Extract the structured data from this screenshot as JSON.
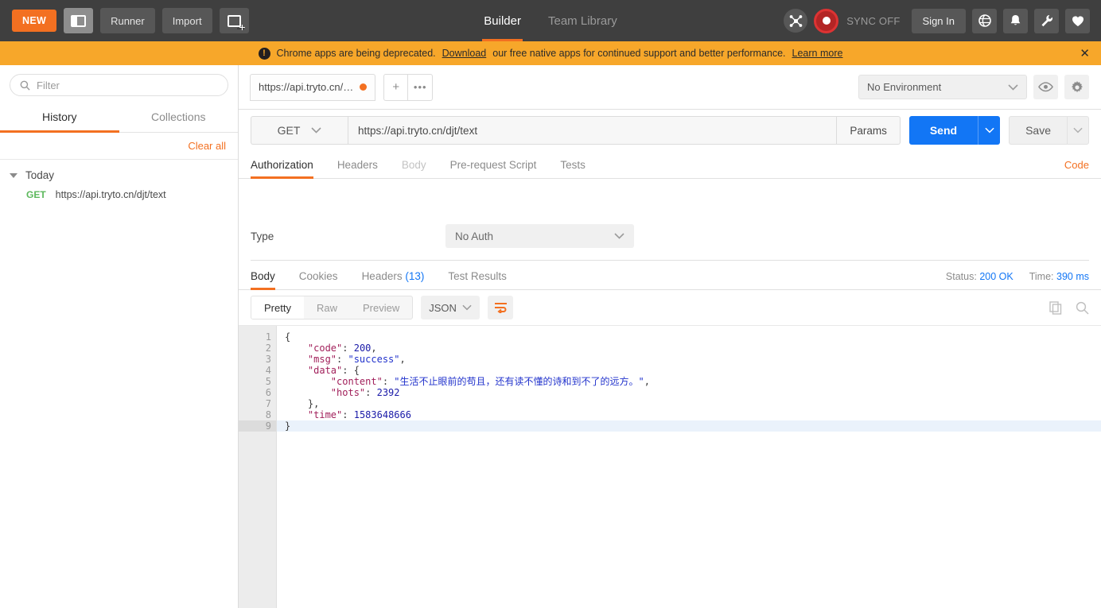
{
  "header": {
    "new_label": "NEW",
    "sidebar_toggle_name": "sidebar-layout-toggle",
    "runner_label": "Runner",
    "import_label": "Import",
    "new_tab_name": "new-window",
    "tabs": [
      {
        "label": "Builder",
        "active": true
      },
      {
        "label": "Team Library",
        "active": false
      }
    ],
    "interceptor_icon": "interceptor-icon",
    "sync_status": "SYNC OFF",
    "sign_in_label": "Sign In",
    "right_icons": [
      "globe-icon",
      "bell-icon",
      "wrench-icon",
      "heart-icon"
    ],
    "accent_color": "#f37021"
  },
  "banner": {
    "icon": "exclamation-icon",
    "text_before": "Chrome apps are being deprecated. ",
    "link1": "Download",
    "text_middle": " our free native apps for continued support and better performance. ",
    "link2": "Learn more",
    "close_label": "✕",
    "background": "#f7a72a"
  },
  "sidebar": {
    "filter_placeholder": "Filter",
    "search_icon": "search-icon",
    "tabs": [
      {
        "label": "History",
        "active": true
      },
      {
        "label": "Collections",
        "active": false
      }
    ],
    "clear_all_label": "Clear all",
    "group_label": "Today",
    "history_items": [
      {
        "method": "GET",
        "url": "https://api.tryto.cn/djt/text"
      }
    ]
  },
  "tabstrip": {
    "request_tab_label": "https://api.tryto.cn/…",
    "unsaved_indicator": "unsaved-dot",
    "add_tab_label": "+",
    "more_tabs_label": "•••",
    "environment_value": "No Environment",
    "eye_icon": "eye-icon",
    "gear_icon": "gear-icon"
  },
  "request": {
    "method": "GET",
    "url": "https://api.tryto.cn/djt/text",
    "params_label": "Params",
    "send_label": "Send",
    "save_label": "Save",
    "tabs": [
      {
        "label": "Authorization",
        "active": true,
        "disabled": false
      },
      {
        "label": "Headers",
        "active": false,
        "disabled": false
      },
      {
        "label": "Body",
        "active": false,
        "disabled": true
      },
      {
        "label": "Pre-request Script",
        "active": false,
        "disabled": false
      },
      {
        "label": "Tests",
        "active": false,
        "disabled": false
      }
    ],
    "code_label": "Code",
    "auth": {
      "type_label": "Type",
      "type_value": "No Auth"
    }
  },
  "response": {
    "tabs": [
      {
        "label": "Body",
        "active": true,
        "count": ""
      },
      {
        "label": "Cookies",
        "active": false,
        "count": ""
      },
      {
        "label": "Headers",
        "active": false,
        "count": "(13)"
      },
      {
        "label": "Test Results",
        "active": false,
        "count": ""
      }
    ],
    "status_label": "Status:",
    "status_value": "200 OK",
    "time_label": "Time:",
    "time_value": "390 ms",
    "view_modes": [
      {
        "label": "Pretty",
        "active": true
      },
      {
        "label": "Raw",
        "active": false
      },
      {
        "label": "Preview",
        "active": false
      }
    ],
    "format": "JSON",
    "wrap_icon": "word-wrap-icon",
    "copy_icon": "copy-icon",
    "search_icon": "search-icon",
    "body_lines": [
      {
        "num": "1",
        "fold": true,
        "highlight": false,
        "tokens": [
          {
            "t": "{",
            "c": "p"
          }
        ]
      },
      {
        "num": "2",
        "fold": false,
        "highlight": false,
        "tokens": [
          {
            "t": "    ",
            "c": "p"
          },
          {
            "t": "\"code\"",
            "c": "k"
          },
          {
            "t": ": ",
            "c": "p"
          },
          {
            "t": "200",
            "c": "n"
          },
          {
            "t": ",",
            "c": "p"
          }
        ]
      },
      {
        "num": "3",
        "fold": false,
        "highlight": false,
        "tokens": [
          {
            "t": "    ",
            "c": "p"
          },
          {
            "t": "\"msg\"",
            "c": "k"
          },
          {
            "t": ": ",
            "c": "p"
          },
          {
            "t": "\"success\"",
            "c": "s"
          },
          {
            "t": ",",
            "c": "p"
          }
        ]
      },
      {
        "num": "4",
        "fold": true,
        "highlight": false,
        "tokens": [
          {
            "t": "    ",
            "c": "p"
          },
          {
            "t": "\"data\"",
            "c": "k"
          },
          {
            "t": ": ",
            "c": "p"
          },
          {
            "t": "{",
            "c": "p"
          }
        ]
      },
      {
        "num": "5",
        "fold": false,
        "highlight": false,
        "tokens": [
          {
            "t": "        ",
            "c": "p"
          },
          {
            "t": "\"content\"",
            "c": "k"
          },
          {
            "t": ": ",
            "c": "p"
          },
          {
            "t": "\"生活不止眼前的苟且，还有读不懂的诗和到不了的远方。\"",
            "c": "s"
          },
          {
            "t": ",",
            "c": "p"
          }
        ]
      },
      {
        "num": "6",
        "fold": false,
        "highlight": false,
        "tokens": [
          {
            "t": "        ",
            "c": "p"
          },
          {
            "t": "\"hots\"",
            "c": "k"
          },
          {
            "t": ": ",
            "c": "p"
          },
          {
            "t": "2392",
            "c": "n"
          }
        ]
      },
      {
        "num": "7",
        "fold": false,
        "highlight": false,
        "tokens": [
          {
            "t": "    ",
            "c": "p"
          },
          {
            "t": "},",
            "c": "p"
          }
        ]
      },
      {
        "num": "8",
        "fold": false,
        "highlight": false,
        "tokens": [
          {
            "t": "    ",
            "c": "p"
          },
          {
            "t": "\"time\"",
            "c": "k"
          },
          {
            "t": ": ",
            "c": "p"
          },
          {
            "t": "1583648666",
            "c": "n"
          }
        ]
      },
      {
        "num": "9",
        "fold": false,
        "highlight": true,
        "tokens": [
          {
            "t": "}",
            "c": "p"
          }
        ]
      }
    ]
  }
}
